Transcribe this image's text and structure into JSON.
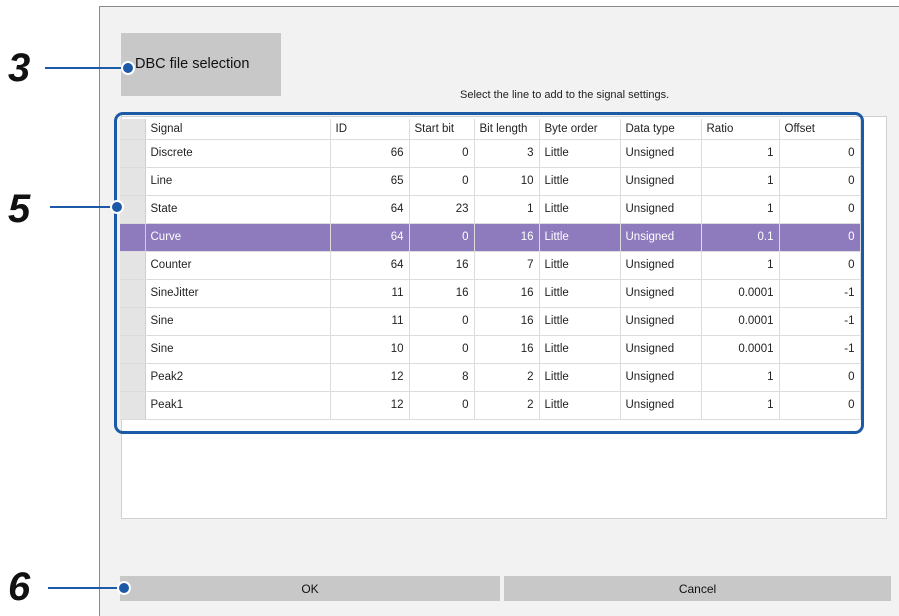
{
  "dialog": {
    "dbc_button_label": "DBC file selection",
    "hint": "Select the line to add to the signal settings.",
    "ok_label": "OK",
    "cancel_label": "Cancel"
  },
  "table": {
    "columns": [
      "Signal",
      "ID",
      "Start bit",
      "Bit length",
      "Byte order",
      "Data type",
      "Ratio",
      "Offset"
    ],
    "rows": [
      [
        "Discrete",
        "66",
        "0",
        "3",
        "Little",
        "Unsigned",
        "1",
        "0"
      ],
      [
        "Line",
        "65",
        "0",
        "10",
        "Little",
        "Unsigned",
        "1",
        "0"
      ],
      [
        "State",
        "64",
        "23",
        "1",
        "Little",
        "Unsigned",
        "1",
        "0"
      ],
      [
        "Curve",
        "64",
        "0",
        "16",
        "Little",
        "Unsigned",
        "0.1",
        "0"
      ],
      [
        "Counter",
        "64",
        "16",
        "7",
        "Little",
        "Unsigned",
        "1",
        "0"
      ],
      [
        "SineJitter",
        "11",
        "16",
        "16",
        "Little",
        "Unsigned",
        "0.0001",
        "-1"
      ],
      [
        "Sine",
        "11",
        "0",
        "16",
        "Little",
        "Unsigned",
        "0.0001",
        "-1"
      ],
      [
        "Sine",
        "10",
        "0",
        "16",
        "Little",
        "Unsigned",
        "0.0001",
        "-1"
      ],
      [
        "Peak2",
        "12",
        "8",
        "2",
        "Little",
        "Unsigned",
        "1",
        "0"
      ],
      [
        "Peak1",
        "12",
        "0",
        "2",
        "Little",
        "Unsigned",
        "1",
        "0"
      ]
    ],
    "selected_row": "Curve",
    "selection_color": "#8e7bbd"
  },
  "callouts": {
    "dbc_selection": "3",
    "signal_table": "5",
    "ok_button": "6",
    "color": "#1c5aa8"
  }
}
